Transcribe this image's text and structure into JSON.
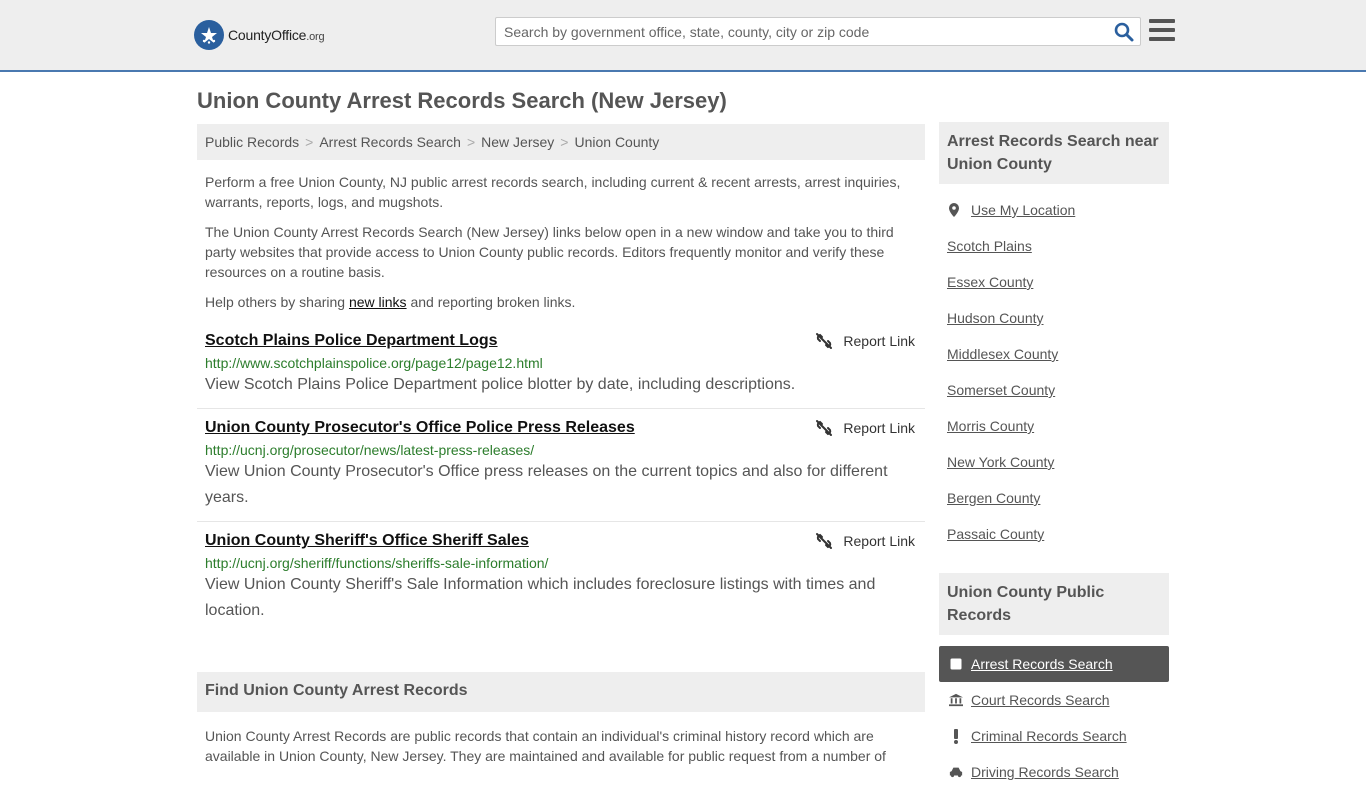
{
  "header": {
    "logo_main": "CountyOffice",
    "logo_tld": ".org",
    "search_placeholder": "Search by government office, state, county, city or zip code"
  },
  "page_title": "Union County Arrest Records Search (New Jersey)",
  "breadcrumb": [
    "Public Records",
    "Arrest Records Search",
    "New Jersey",
    "Union County"
  ],
  "breadcrumb_separator": ">",
  "intro": {
    "p1": "Perform a free Union County, NJ public arrest records search, including current & recent arrests, arrest inquiries, warrants, reports, logs, and mugshots.",
    "p2": "The Union County Arrest Records Search (New Jersey) links below open in a new window and take you to third party websites that provide access to Union County public records. Editors frequently monitor and verify these resources on a routine basis.",
    "p3_before": "Help others by sharing ",
    "p3_link": "new links",
    "p3_after": " and reporting broken links."
  },
  "report_label": "Report Link",
  "results": [
    {
      "title": "Scotch Plains Police Department Logs",
      "url": "http://www.scotchplainspolice.org/page12/page12.html",
      "desc": "View Scotch Plains Police Department police blotter by date, including descriptions."
    },
    {
      "title": "Union County Prosecutor's Office Police Press Releases",
      "url": "http://ucnj.org/prosecutor/news/latest-press-releases/",
      "desc": "View Union County Prosecutor's Office press releases on the current topics and also for different years."
    },
    {
      "title": "Union County Sheriff's Office Sheriff Sales",
      "url": "http://ucnj.org/sheriff/functions/sheriffs-sale-information/",
      "desc": "View Union County Sheriff's Sale Information which includes foreclosure listings with times and location."
    }
  ],
  "find": {
    "heading": "Find Union County Arrest Records",
    "body": "Union County Arrest Records are public records that contain an individual's criminal history record which are available in Union County, New Jersey. They are maintained and available for public request from a number of"
  },
  "sidebar": {
    "near_heading": "Arrest Records Search near Union County",
    "use_location": "Use My Location",
    "near_items": [
      "Scotch Plains",
      "Essex County",
      "Hudson County",
      "Middlesex County",
      "Somerset County",
      "Morris County",
      "New York County",
      "Bergen County",
      "Passaic County"
    ],
    "public_heading": "Union County Public Records",
    "public_items": [
      {
        "label": "Arrest Records Search",
        "icon": "square-icon",
        "active": true
      },
      {
        "label": "Court Records Search",
        "icon": "courthouse-icon",
        "active": false
      },
      {
        "label": "Criminal Records Search",
        "icon": "exclamation-icon",
        "active": false
      },
      {
        "label": "Driving Records Search",
        "icon": "car-icon",
        "active": false
      }
    ]
  },
  "colors": {
    "header_bg": "#eeeeee",
    "header_border": "#4a79b0",
    "link_url_green": "#2c7d2c",
    "active_nav_bg": "#555555",
    "search_icon": "#2a5f9e"
  }
}
